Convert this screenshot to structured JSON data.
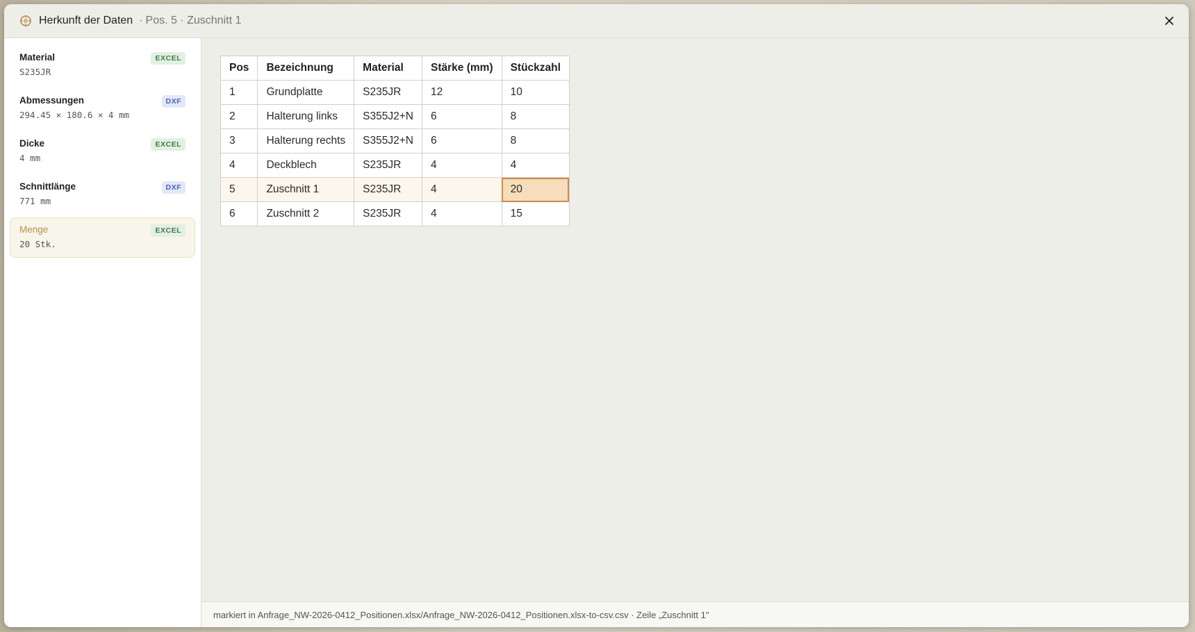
{
  "header": {
    "title": "Herkunft der Daten",
    "separator": "·",
    "subtitle": "Pos. 5 · Zuschnitt 1",
    "icon": "crosshair-icon",
    "close_icon": "close-icon",
    "accent_color": "#b3914a"
  },
  "sidebar": {
    "items": [
      {
        "name": "Material",
        "value": "S235JR",
        "badge": "EXCEL"
      },
      {
        "name": "Abmessungen",
        "value": "294.45 × 180.6 × 4 mm",
        "badge": "DXF"
      },
      {
        "name": "Dicke",
        "value": "4 mm",
        "badge": "EXCEL"
      },
      {
        "name": "Schnittlänge",
        "value": "771 mm",
        "badge": "DXF"
      },
      {
        "name": "Menge",
        "value": "20 Stk.",
        "badge": "EXCEL",
        "active": true
      }
    ]
  },
  "table": {
    "headers": [
      "Pos",
      "Bezeichnung",
      "Material",
      "Stärke (mm)",
      "Stückzahl"
    ],
    "rows": [
      [
        "1",
        "Grundplatte",
        "S235JR",
        "12",
        "10"
      ],
      [
        "2",
        "Halterung links",
        "S355J2+N",
        "6",
        "8"
      ],
      [
        "3",
        "Halterung rechts",
        "S355J2+N",
        "6",
        "8"
      ],
      [
        "4",
        "Deckblech",
        "S235JR",
        "4",
        "4"
      ],
      [
        "5",
        "Zuschnitt 1",
        "S235JR",
        "4",
        "20"
      ],
      [
        "6",
        "Zuschnitt 2",
        "S235JR",
        "4",
        "15"
      ]
    ],
    "highlight_color": "#f6ddbb",
    "marked_border_color": "#d08a4a"
  },
  "footer": {
    "text": "markiert in Anfrage_NW-2026-0412_Positionen.xlsx/Anfrage_NW-2026-0412_Positionen.xlsx-to-csv.csv · Zeile „Zuschnitt 1\""
  }
}
